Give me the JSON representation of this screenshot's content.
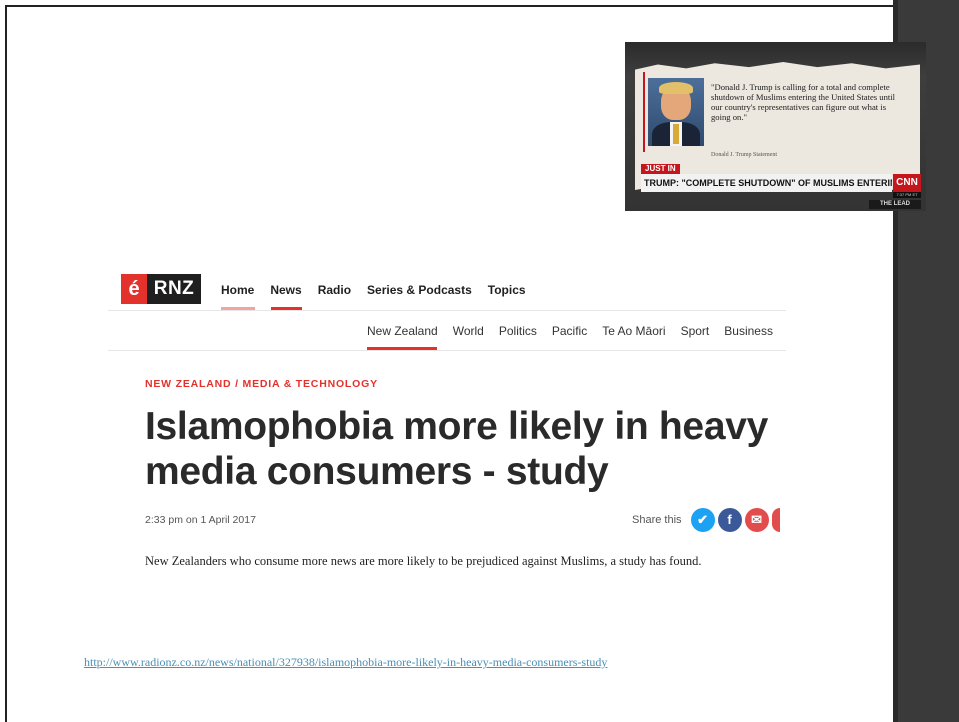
{
  "cnn_clip": {
    "quote": "\"Donald J. Trump is calling for a total and complete shutdown of Muslims entering the United States until our country's representatives can figure out what is going on.\"",
    "attribution": "Donald J. Trump Statement",
    "badge": "JUST IN",
    "crawl": "TRUMP: \"COMPLETE SHUTDOWN\" OF MUSLIMS ENTERING U.S.",
    "logo": "CNN",
    "time": "7:37 PM ET",
    "show": "THE LEAD"
  },
  "rnz": {
    "logo_text": "RNZ",
    "nav": [
      {
        "label": "Home"
      },
      {
        "label": "News"
      },
      {
        "label": "Radio"
      },
      {
        "label": "Series & Podcasts"
      },
      {
        "label": "Topics"
      }
    ],
    "subnav": [
      {
        "label": "New Zealand"
      },
      {
        "label": "World"
      },
      {
        "label": "Politics"
      },
      {
        "label": "Pacific"
      },
      {
        "label": "Te Ao Māori"
      },
      {
        "label": "Sport"
      },
      {
        "label": "Business"
      }
    ],
    "category": "NEW ZEALAND / MEDIA & TECHNOLOGY",
    "headline": "Islamophobia more likely in heavy media consumers - study",
    "timestamp": "2:33 pm on 1 April 2017",
    "share_label": "Share this",
    "lede": "New Zealanders who consume more news are more likely to be prejudiced against Muslims, a study has found."
  },
  "source_url": "http://www.radionz.co.nz/news/national/327938/islamophobia-more-likely-in-heavy-media-consumers-study"
}
